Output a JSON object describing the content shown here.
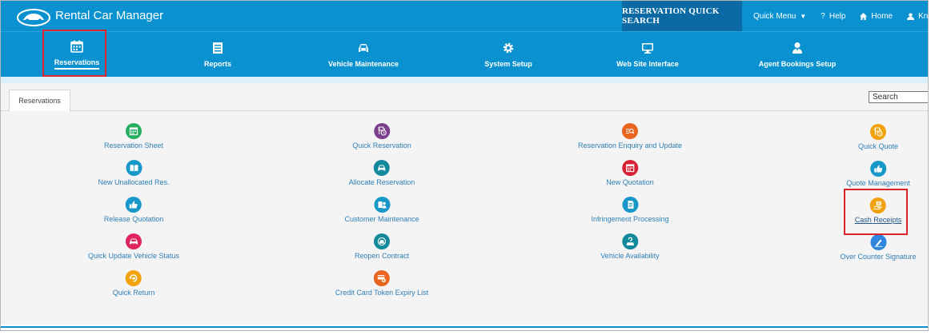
{
  "topbar": {
    "app_title": "Rental Car Manager",
    "quick_search": "RESERVATION QUICK SEARCH",
    "quick_menu": "Quick Menu",
    "help": "Help",
    "home": "Home",
    "user": "Kno"
  },
  "nav": {
    "items": [
      {
        "label": "Reservations",
        "icon": "calendar-icon"
      },
      {
        "label": "Reports",
        "icon": "report-icon"
      },
      {
        "label": "Vehicle Maintenance",
        "icon": "car-icon"
      },
      {
        "label": "System Setup",
        "icon": "gear-icon"
      },
      {
        "label": "Web Site Interface",
        "icon": "monitor-icon"
      },
      {
        "label": "Agent Bookings Setup",
        "icon": "agent-icon"
      }
    ]
  },
  "content": {
    "tab": "Reservations",
    "search_placeholder": "Search",
    "menu": [
      {
        "label": "Reservation Sheet",
        "color": "#27ae60",
        "icon": "calendar-icon"
      },
      {
        "label": "New Unallocated Res.",
        "color": "#1798c9",
        "icon": "book-icon"
      },
      {
        "label": "Release Quotation",
        "color": "#1798c9",
        "icon": "thumbs-up-icon"
      },
      {
        "label": "Quick Update Vehicle Status",
        "color": "#e0245e",
        "icon": "car-icon"
      },
      {
        "label": "Quick Return",
        "color": "#f2a20c",
        "icon": "return-car-icon"
      },
      {
        "label": "Quick Reservation",
        "color": "#7b3f8c",
        "icon": "clock-document-icon"
      },
      {
        "label": "Allocate Reservation",
        "color": "#138a9c",
        "icon": "car-icon"
      },
      {
        "label": "Customer Maintenance",
        "color": "#1798c9",
        "icon": "users-icon"
      },
      {
        "label": "Reopen Contract",
        "color": "#138a9c",
        "icon": "car-icon"
      },
      {
        "label": "Credit Card Token Expiry List",
        "color": "#e8641f",
        "icon": "card-cancel-icon"
      },
      {
        "label": "Reservation Enquiry and Update",
        "color": "#e8641f",
        "icon": "search-list-icon"
      },
      {
        "label": "New Quotation",
        "color": "#d62134",
        "icon": "calendar-icon"
      },
      {
        "label": "Infringement Processing",
        "color": "#1798c9",
        "icon": "document-icon"
      },
      {
        "label": "Vehicle Availability",
        "color": "#138a9c",
        "icon": "question-car-icon"
      },
      {
        "label": "Quick Quote",
        "color": "#f2a20c",
        "icon": "clock-document-icon"
      },
      {
        "label": "Quote Management",
        "color": "#1798c9",
        "icon": "thumbs-up-icon"
      },
      {
        "label": "Cash Receipts",
        "color": "#f2a20c",
        "icon": "cash-icon"
      },
      {
        "label": "Over Counter Signature",
        "color": "#2e86de",
        "icon": "pen-icon"
      }
    ]
  }
}
